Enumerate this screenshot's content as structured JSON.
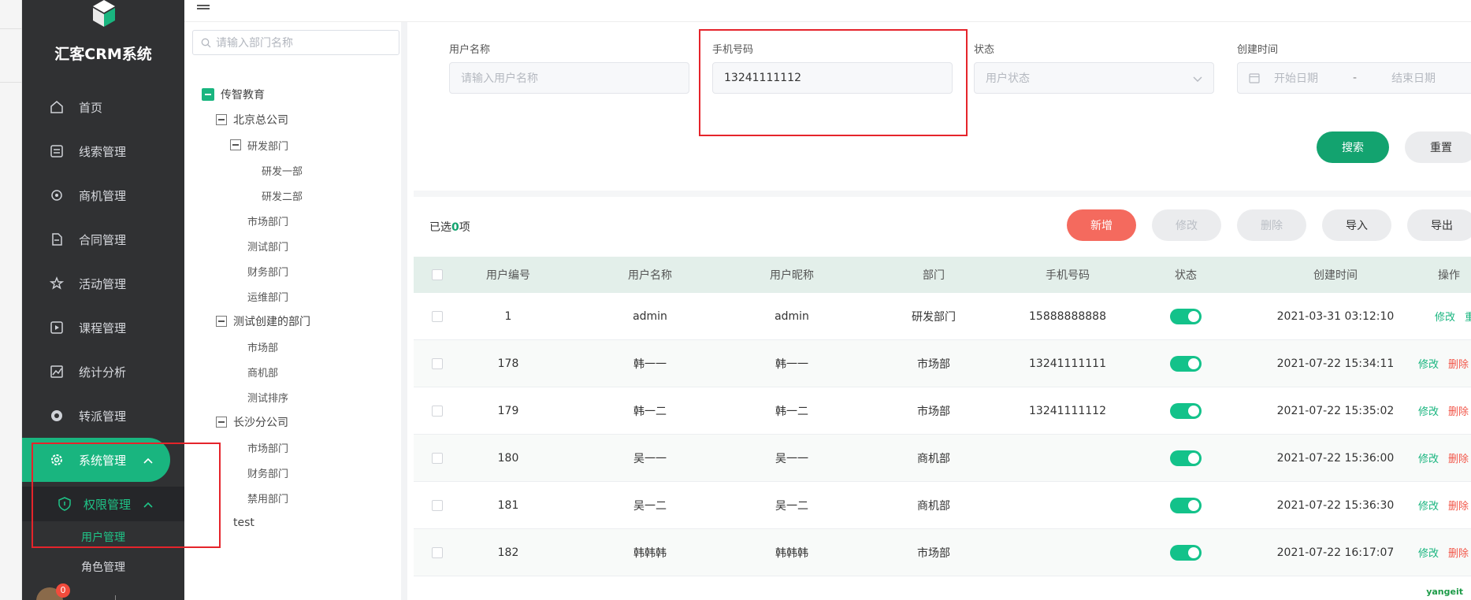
{
  "app": {
    "title": "汇客CRM系统"
  },
  "sidebar": {
    "items": [
      {
        "label": "首页",
        "icon": "home-icon"
      },
      {
        "label": "线索管理",
        "icon": "clue-icon"
      },
      {
        "label": "商机管理",
        "icon": "target-icon"
      },
      {
        "label": "合同管理",
        "icon": "document-icon"
      },
      {
        "label": "活动管理",
        "icon": "star-icon"
      },
      {
        "label": "课程管理",
        "icon": "play-icon"
      },
      {
        "label": "统计分析",
        "icon": "chart-icon"
      },
      {
        "label": "转派管理",
        "icon": "transfer-icon"
      },
      {
        "label": "系统管理",
        "icon": "gear-icon"
      }
    ],
    "submenu": {
      "label": "权限管理",
      "icon": "shield-icon"
    },
    "leaves": [
      {
        "label": "用户管理"
      },
      {
        "label": "角色管理"
      }
    ],
    "user": {
      "badge": "0"
    }
  },
  "tree": {
    "search_placeholder": "请输入部门名称",
    "nodes": [
      {
        "label": "传智教育"
      },
      {
        "label": "北京总公司"
      },
      {
        "label": "研发部门"
      },
      {
        "label": "研发一部"
      },
      {
        "label": "研发二部"
      },
      {
        "label": "市场部门"
      },
      {
        "label": "测试部门"
      },
      {
        "label": "财务部门"
      },
      {
        "label": "运维部门"
      },
      {
        "label": "测试创建的部门"
      },
      {
        "label": "市场部"
      },
      {
        "label": "商机部"
      },
      {
        "label": "测试排序"
      },
      {
        "label": "长沙分公司"
      },
      {
        "label": "市场部门"
      },
      {
        "label": "财务部门"
      },
      {
        "label": "禁用部门"
      },
      {
        "label": "test"
      }
    ]
  },
  "filters": {
    "username": {
      "label": "用户名称",
      "placeholder": "请输入用户名称"
    },
    "phone": {
      "label": "手机号码",
      "value": "13241111112"
    },
    "status": {
      "label": "状态",
      "placeholder": "用户状态"
    },
    "created": {
      "label": "创建时间",
      "start_placeholder": "开始日期",
      "separator": "-",
      "end_placeholder": "结束日期"
    },
    "search_button": "搜索",
    "reset_button": "重置"
  },
  "toolbar": {
    "selected_prefix": "已选",
    "selected_count": "0",
    "selected_suffix": "项",
    "add": "新增",
    "edit": "修改",
    "delete": "删除",
    "import": "导入",
    "export": "导出"
  },
  "table": {
    "headers": [
      "用户编号",
      "用户名称",
      "用户昵称",
      "部门",
      "手机号码",
      "状态",
      "创建时间",
      "操作"
    ],
    "rows": [
      {
        "id": "1",
        "name": "admin",
        "nick": "admin",
        "dept": "研发部门",
        "phone": "15888888888",
        "created": "2021-03-31 03:12:10",
        "op1": "修改",
        "op2": "重"
      },
      {
        "id": "178",
        "name": "韩一一",
        "nick": "韩一一",
        "dept": "市场部",
        "phone": "13241111111",
        "created": "2021-07-22 15:34:11",
        "op1": "修改",
        "op2": "删除"
      },
      {
        "id": "179",
        "name": "韩一二",
        "nick": "韩一二",
        "dept": "市场部",
        "phone": "13241111112",
        "created": "2021-07-22 15:35:02",
        "op1": "修改",
        "op2": "删除"
      },
      {
        "id": "180",
        "name": "吴一一",
        "nick": "吴一一",
        "dept": "商机部",
        "phone": "",
        "created": "2021-07-22 15:36:00",
        "op1": "修改",
        "op2": "删除"
      },
      {
        "id": "181",
        "name": "吴一二",
        "nick": "吴一二",
        "dept": "商机部",
        "phone": "",
        "created": "2021-07-22 15:36:30",
        "op1": "修改",
        "op2": "删除"
      },
      {
        "id": "182",
        "name": "韩韩韩",
        "nick": "韩韩韩",
        "dept": "市场部",
        "phone": "",
        "created": "2021-07-22 16:17:07",
        "op1": "修改",
        "op2": "删除"
      }
    ]
  },
  "watermark": "yangeit",
  "colors": {
    "accent": "#19b57f",
    "sidebar": "#303133",
    "danger": "#f46a5e",
    "highlight": "#e5242b"
  }
}
